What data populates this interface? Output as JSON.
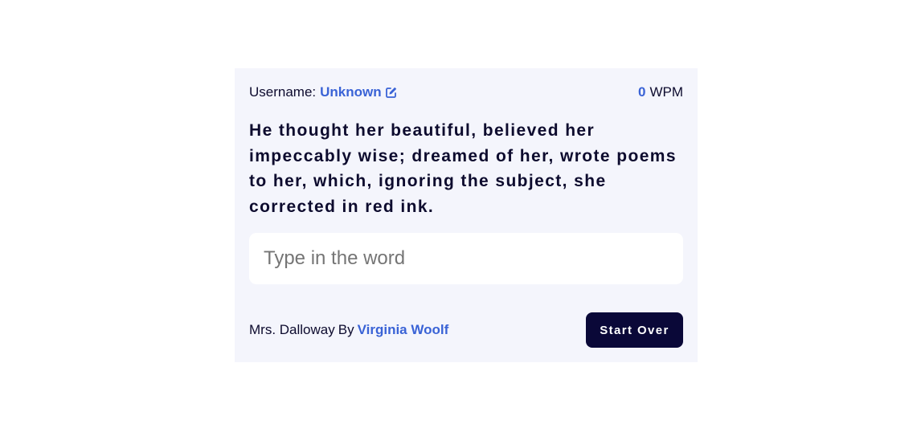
{
  "header": {
    "username_label": "Username:",
    "username_value": "Unknown",
    "wpm_value": "0",
    "wpm_unit": "WPM"
  },
  "quote": {
    "text": "He thought her beautiful, believed her impeccably wise; dreamed of her, wrote poems to her, which, ignoring the subject, she corrected in red ink."
  },
  "input": {
    "placeholder": "Type in the word",
    "value": ""
  },
  "footer": {
    "book_title": "Mrs. Dalloway",
    "by_label": "By",
    "author": "Virginia Woolf",
    "start_over_label": "Start Over"
  },
  "icons": {
    "edit": "edit-icon"
  },
  "colors": {
    "accent": "#3a63d6",
    "text": "#0d0b2e",
    "card_background": "#f4f5fc",
    "button_background": "#0a0838"
  }
}
